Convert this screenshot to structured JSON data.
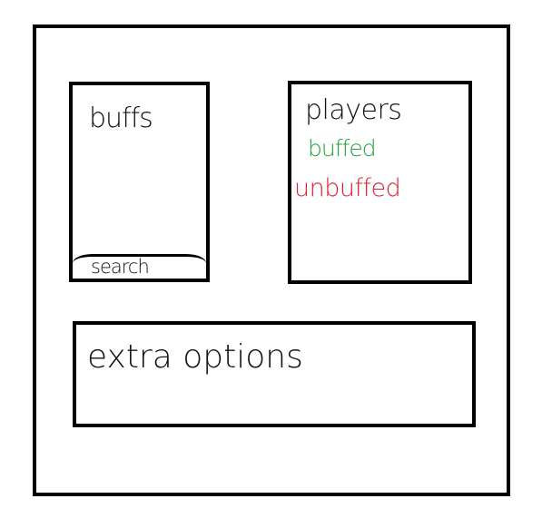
{
  "buffs_panel": {
    "title": "buffs",
    "search_label": "search"
  },
  "players_panel": {
    "title": "players",
    "buffed_label": "buffed",
    "unbuffed_label": "unbuffed"
  },
  "extra_panel": {
    "title": "extra options"
  },
  "colors": {
    "buffed": "#22a33a",
    "unbuffed": "#e0202c",
    "ink": "#000000"
  }
}
